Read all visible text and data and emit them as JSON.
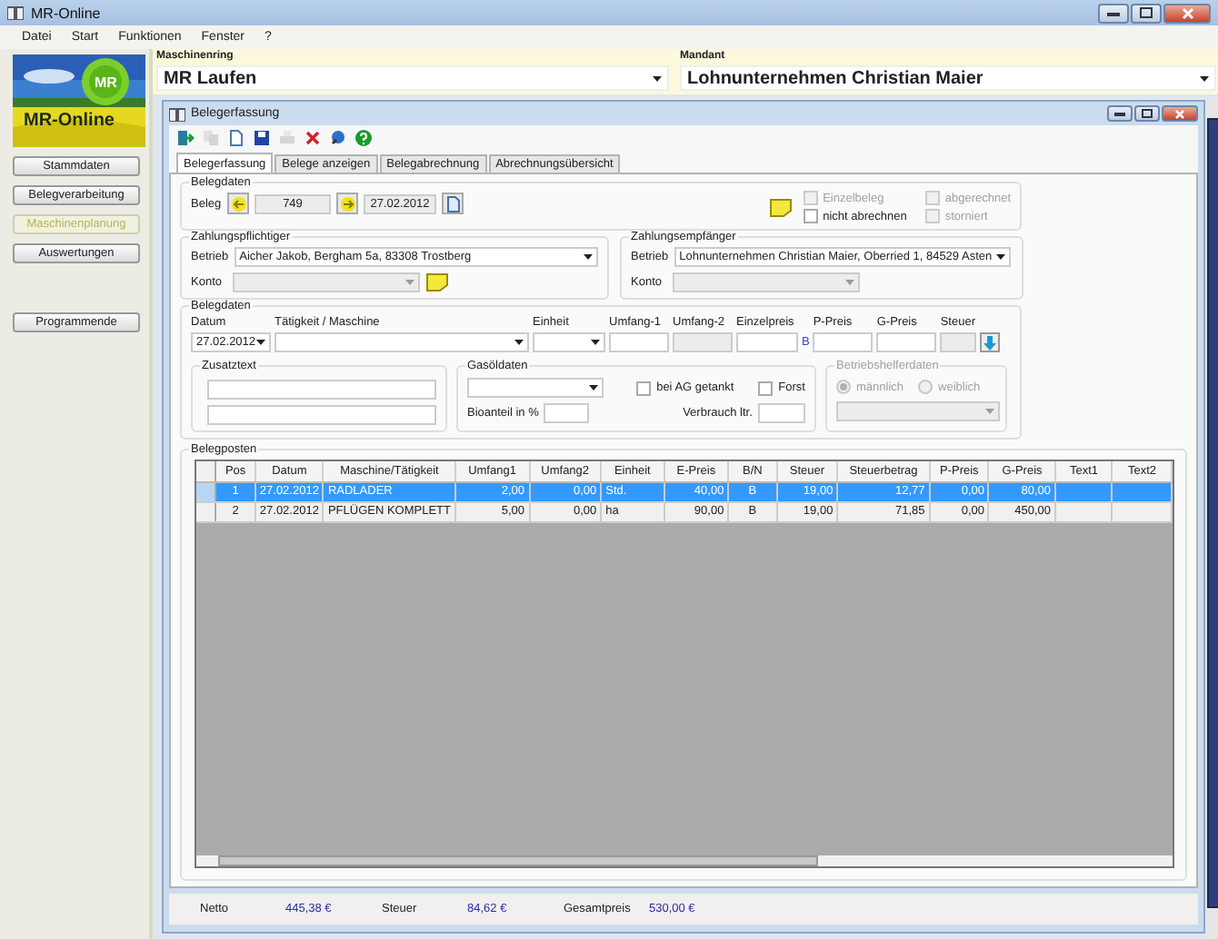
{
  "window": {
    "title": "MR-Online"
  },
  "menu": [
    {
      "label": "Datei"
    },
    {
      "label": "Start"
    },
    {
      "label": "Funktionen"
    },
    {
      "label": "Fenster"
    },
    {
      "label": "?"
    }
  ],
  "sidebar": {
    "logo": {
      "badge": "MR",
      "title": "MR-Online"
    },
    "buttons": [
      {
        "label": "Stammdaten",
        "disabled": false
      },
      {
        "label": "Belegverarbeitung",
        "disabled": false
      },
      {
        "label": "Maschinenplanung",
        "disabled": true
      },
      {
        "label": "Auswertungen",
        "disabled": false
      }
    ],
    "exit_button": "Programmende"
  },
  "header": {
    "maschinenring": {
      "label": "Maschinenring",
      "value": "MR Laufen"
    },
    "mandant": {
      "label": "Mandant",
      "value": "Lohnunternehmen  Christian Maier"
    }
  },
  "child_window": {
    "title": "Belegerfassung"
  },
  "toolbar": [
    {
      "kind": "exit",
      "disabled": false
    },
    {
      "kind": "copy",
      "disabled": true
    },
    {
      "kind": "new",
      "disabled": false
    },
    {
      "kind": "save",
      "disabled": false
    },
    {
      "kind": "print",
      "disabled": true
    },
    {
      "kind": "delete",
      "disabled": false
    },
    {
      "kind": "search",
      "disabled": false
    },
    {
      "kind": "help",
      "disabled": false
    }
  ],
  "tabs": [
    {
      "label": "Belegerfassung",
      "selected": true
    },
    {
      "label": "Belege anzeigen",
      "selected": false
    },
    {
      "label": "Belegabrechnung",
      "selected": false
    },
    {
      "label": "Abrechnungsübersicht",
      "selected": false
    }
  ],
  "beleg": {
    "title": "Belegdaten",
    "label": "Beleg",
    "number": "749",
    "date": "27.02.2012"
  },
  "flags": [
    {
      "label": "Einzelbeleg",
      "checked": false,
      "disabled": true
    },
    {
      "label": "abgerechnet",
      "checked": false,
      "disabled": true
    },
    {
      "label": "nicht abrechnen",
      "checked": false,
      "disabled": false
    },
    {
      "label": "storniert",
      "checked": false,
      "disabled": true
    }
  ],
  "payer": {
    "title": "Zahlungspflichtiger",
    "betrieb_label": "Betrieb",
    "betrieb": "Aicher Jakob, Bergham 5a, 83308  Trostberg",
    "konto_label": "Konto"
  },
  "payee": {
    "title": "Zahlungsempfänger",
    "betrieb_label": "Betrieb",
    "betrieb": "Lohnunternehmen  Christian Maier, Oberried 1, 84529  Asten",
    "konto_label": "Konto"
  },
  "entry": {
    "title": "Belegdaten",
    "fields": [
      {
        "label": "Datum",
        "kind": "dropdown",
        "value": "27.02.2012"
      },
      {
        "label": "Tätigkeit / Maschine",
        "kind": "dropdown"
      },
      {
        "label": "Einheit",
        "kind": "dropdown"
      },
      {
        "label": "Umfang-1",
        "kind": "text"
      },
      {
        "label": "Umfang-2",
        "kind": "readonly"
      },
      {
        "label": "Einzelpreis",
        "kind": "text",
        "suffix": "B"
      },
      {
        "label": "P-Preis",
        "kind": "text"
      },
      {
        "label": "G-Preis",
        "kind": "text"
      },
      {
        "label": "Steuer",
        "kind": "readonly"
      }
    ]
  },
  "zusatztext": {
    "title": "Zusatztext"
  },
  "gasoel": {
    "title": "Gasöldaten",
    "ag_label": "bei AG getankt",
    "ag_checked": false,
    "forst_label": "Forst",
    "forst_checked": false,
    "bio_label": "Bioanteil in %",
    "verbrauch_label": "Verbrauch ltr."
  },
  "helfer": {
    "title": "Betriebshelferdaten",
    "options": [
      {
        "label": "männlich",
        "selected": true
      },
      {
        "label": "weiblich",
        "selected": false
      }
    ]
  },
  "table": {
    "title": "Belegposten",
    "columns": [
      "Pos",
      "Datum",
      "Maschine/Tätigkeit",
      "Umfang1",
      "Umfang2",
      "Einheit",
      "E-Preis",
      "B/N",
      "Steuer",
      "Steuerbetrag",
      "P-Preis",
      "G-Preis",
      "Text1",
      "Text2"
    ],
    "rows": [
      {
        "selected": true,
        "cells": [
          "1",
          "27.02.2012",
          "RADLADER",
          "2,00",
          "0,00",
          "Std.",
          "40,00",
          "B",
          "19,00",
          "12,77",
          "0,00",
          "80,00"
        ]
      },
      {
        "selected": false,
        "cells": [
          "2",
          "27.02.2012",
          "PFLÜGEN KOMPLETT",
          "5,00",
          "0,00",
          "ha",
          "90,00",
          "B",
          "19,00",
          "71,85",
          "0,00",
          "450,00"
        ]
      }
    ]
  },
  "totals": [
    {
      "label": "Netto",
      "value": "445,38 €"
    },
    {
      "label": "Steuer",
      "value": "84,62 €"
    },
    {
      "label": "Gesamtpreis",
      "value": "530,00 €"
    }
  ]
}
